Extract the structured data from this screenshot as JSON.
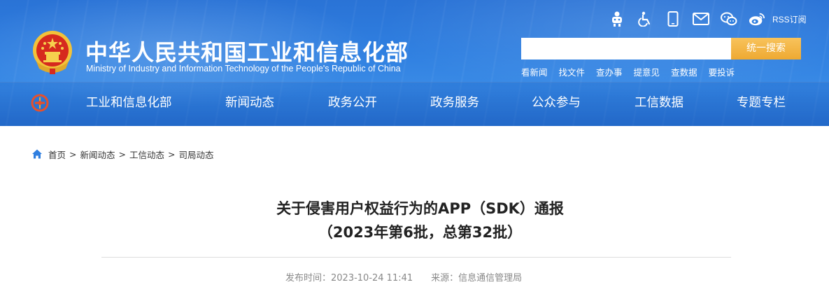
{
  "header": {
    "title": "中华人民共和国工业和信息化部",
    "subtitle": "Ministry of Industry and Information Technology of the People's Republic of China",
    "util_icons": [
      "accessibility-robot-icon",
      "wheelchair-icon",
      "mobile-icon",
      "mail-icon",
      "wechat-icon",
      "weibo-icon"
    ],
    "rss_label": "RSS订阅",
    "search": {
      "placeholder": "",
      "value": "",
      "button_label": "统一搜索"
    },
    "quick_links": [
      "看新闻",
      "找文件",
      "查办事",
      "提意见",
      "查数据",
      "要投诉"
    ],
    "colors": {
      "header_blue": "#2f7fe0",
      "search_button": "#eea932"
    }
  },
  "nav": {
    "items": [
      "工业和信息化部",
      "新闻动态",
      "政务公开",
      "政务服务",
      "公众参与",
      "工信数据",
      "专题专栏"
    ]
  },
  "breadcrumb": {
    "items": [
      "首页",
      "新闻动态",
      "工信动态",
      "司局动态"
    ],
    "separator": ">"
  },
  "article": {
    "title_line1": "关于侵害用户权益行为的APP（SDK）通报",
    "title_line2": "（2023年第6批，总第32批）",
    "publish_time": "发布时间：2023-10-24 11:41",
    "source": "来源：信息通信管理局"
  }
}
